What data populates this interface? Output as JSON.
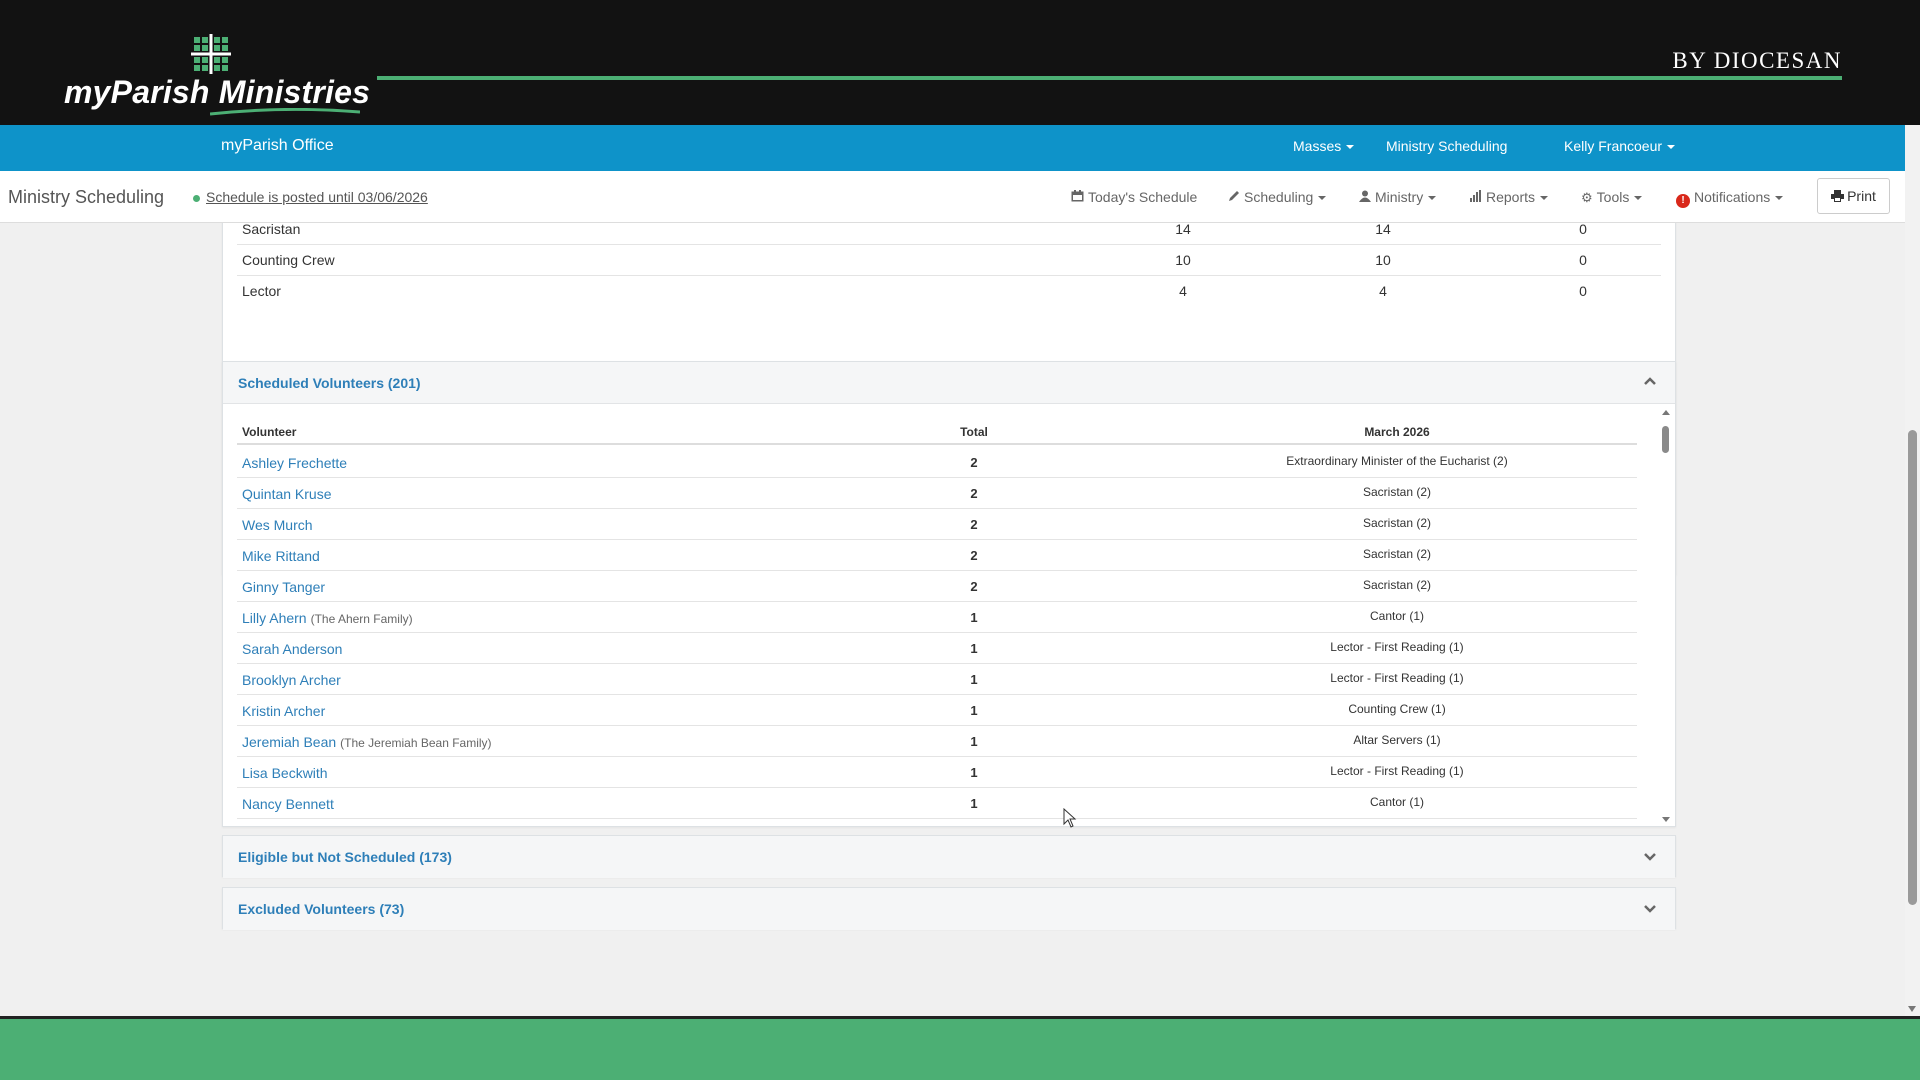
{
  "brand": {
    "logo_text": "myParish Ministries",
    "byline": "BY DIOCESAN"
  },
  "bluenav": {
    "office": "myParish Office",
    "masses": "Masses",
    "ministry_scheduling": "Ministry Scheduling",
    "user": "Kelly Francoeur"
  },
  "subbar": {
    "title": "Ministry Scheduling",
    "posted": "Schedule is posted until 03/06/2026",
    "todays_schedule": "Today's Schedule",
    "scheduling": "Scheduling",
    "ministry": "Ministry",
    "reports": "Reports",
    "tools": "Tools",
    "notifications": "Notifications",
    "print": "Print"
  },
  "summary_rows": [
    {
      "name": "Sacristan",
      "a": "14",
      "b": "14",
      "c": "0"
    },
    {
      "name": "Counting Crew",
      "a": "10",
      "b": "10",
      "c": "0"
    },
    {
      "name": "Lector",
      "a": "4",
      "b": "4",
      "c": "0"
    }
  ],
  "scheduled": {
    "title": "Scheduled Volunteers (201)",
    "headers": {
      "volunteer": "Volunteer",
      "total": "Total",
      "month": "March 2026"
    },
    "rows": [
      {
        "name": "Ashley Frechette",
        "family": "",
        "total": "2",
        "ministry": "Extraordinary Minister of the Eucharist (2)"
      },
      {
        "name": "Quintan Kruse",
        "family": "",
        "total": "2",
        "ministry": "Sacristan (2)"
      },
      {
        "name": "Wes Murch",
        "family": "",
        "total": "2",
        "ministry": "Sacristan (2)"
      },
      {
        "name": "Mike Rittand",
        "family": "",
        "total": "2",
        "ministry": "Sacristan (2)"
      },
      {
        "name": "Ginny Tanger",
        "family": "",
        "total": "2",
        "ministry": "Sacristan (2)"
      },
      {
        "name": "Lilly Ahern",
        "family": "(The Ahern Family)",
        "total": "1",
        "ministry": "Cantor (1)"
      },
      {
        "name": "Sarah Anderson",
        "family": "",
        "total": "1",
        "ministry": "Lector - First Reading (1)"
      },
      {
        "name": "Brooklyn Archer",
        "family": "",
        "total": "1",
        "ministry": "Lector - First Reading (1)"
      },
      {
        "name": "Kristin Archer",
        "family": "",
        "total": "1",
        "ministry": "Counting Crew (1)"
      },
      {
        "name": "Jeremiah Bean",
        "family": "(The Jeremiah Bean Family)",
        "total": "1",
        "ministry": "Altar Servers (1)"
      },
      {
        "name": "Lisa Beckwith",
        "family": "",
        "total": "1",
        "ministry": "Lector - First Reading (1)"
      },
      {
        "name": "Nancy Bennett",
        "family": "",
        "total": "1",
        "ministry": "Cantor (1)"
      }
    ]
  },
  "eligible": {
    "title": "Eligible but Not Scheduled (173)"
  },
  "excluded": {
    "title": "Excluded Volunteers (73)"
  },
  "colors": {
    "brand_green": "#4caf74",
    "nav_blue": "#0e93c9",
    "link_blue": "#2e7fb8",
    "alert_red": "#d9281a"
  }
}
